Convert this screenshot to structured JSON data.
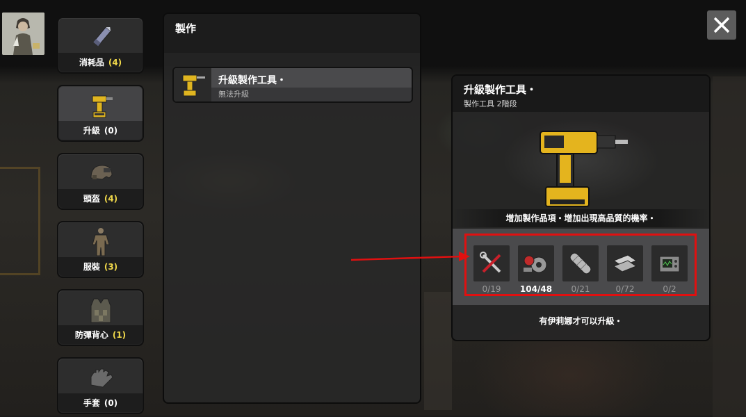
{
  "sidebar": {
    "categories": [
      {
        "label": "消耗品",
        "count": "(4)",
        "icon": "ammo-icon"
      },
      {
        "label": "升級",
        "count": "(0)",
        "icon": "drill-icon"
      },
      {
        "label": "頭盔",
        "count": "(4)",
        "icon": "helmet-icon"
      },
      {
        "label": "服裝",
        "count": "(3)",
        "icon": "outfit-icon"
      },
      {
        "label": "防彈背心",
        "count": "(1)",
        "icon": "vest-icon"
      },
      {
        "label": "手套",
        "count": "(0)",
        "icon": "glove-icon"
      }
    ],
    "active_index": 1
  },
  "craft_panel": {
    "title": "製作",
    "recipe": {
      "name": "升級製作工具・",
      "status": "無法升級",
      "icon": "drill-icon"
    }
  },
  "detail": {
    "title": "升級製作工具・",
    "subtitle": "製作工具 2階段",
    "description": "增加製作品項・增加出現高品質的機率・",
    "materials": [
      {
        "icon": "tools-icon",
        "amount": "0/19",
        "sufficient": false
      },
      {
        "icon": "gear-parts-icon",
        "amount": "104/48",
        "sufficient": true
      },
      {
        "icon": "pipe-icon",
        "amount": "0/21",
        "sufficient": false
      },
      {
        "icon": "metal-plate-icon",
        "amount": "0/72",
        "sufficient": false
      },
      {
        "icon": "electronics-icon",
        "amount": "0/2",
        "sufficient": false
      }
    ],
    "footer": "有伊莉娜才可以升級・"
  },
  "colors": {
    "highlight_box": "#e01010",
    "count_accent": "#f0d84a"
  }
}
